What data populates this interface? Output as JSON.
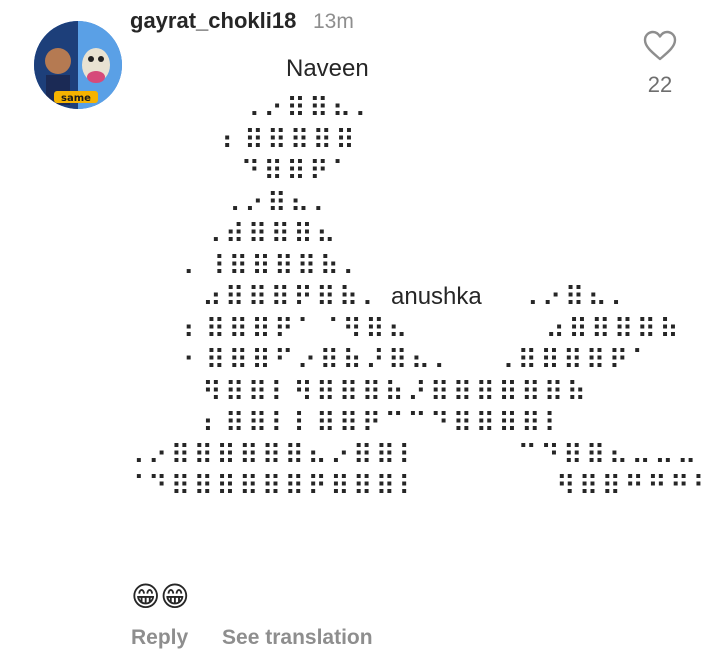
{
  "comment": {
    "username": "gayrat_chokli18",
    "time": "13m",
    "likes": "22",
    "labels": {
      "top": "Naveen",
      "side": "anushka"
    },
    "braille_art": [
      "      ⠠⠔⠿⠿⠦⠄",
      "     ⠆⠿⠿⠿⠿⠿",
      "      ⠙⠿⠿⠟⠁",
      "     ⠠⠔⠿⠦⠄",
      "    ⠠⠾⠿⠿⠿⠦",
      "   ⠄⠸⠿⠿⠿⠿⠷⠄",
      "    ⠴⠿⠿⠿⠟⠿⠷⠄       ⠠⠔⠿⠦⠄",
      "   ⠆⠿⠿⠿⠟⠁⠈⠻⠿⠦       ⠴⠿⠿⠿⠿⠷",
      "   ⠂⠿⠿⠿⠋⠔⠿⠷⠜⠿⠦⠄  ⠠⠿⠿⠿⠿⠟⠁",
      "    ⠻⠿⠿⠇⠻⠿⠿⠿⠷⠜⠿⠿⠿⠿⠿⠿⠷",
      "    ⠆⠿⠿⠇⠇⠿⠿⠟⠉⠉⠙⠿⠿⠿⠿⠇",
      "⠠⠔⠿⠿⠿⠿⠿⠿⠦⠔⠿⠿⠇     ⠉⠙⠿⠿⠦⠤⠤⠤",
      "⠈⠙⠿⠿⠿⠿⠿⠿⠟⠿⠿⠿⠇       ⠻⠿⠿⠛⠛⠛⠃"
    ],
    "emoji": "😁😁",
    "actions": {
      "reply": "Reply",
      "translate": "See translation"
    }
  }
}
